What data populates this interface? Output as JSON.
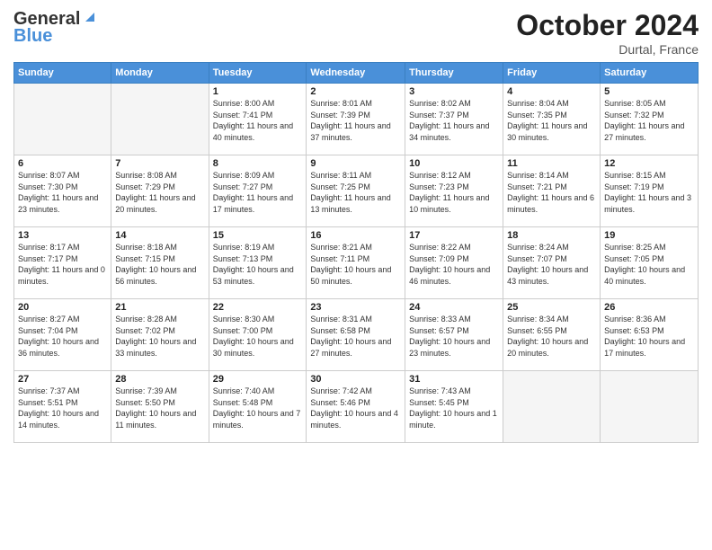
{
  "header": {
    "logo_line1": "General",
    "logo_line2": "Blue",
    "month": "October 2024",
    "location": "Durtal, France"
  },
  "days_of_week": [
    "Sunday",
    "Monday",
    "Tuesday",
    "Wednesday",
    "Thursday",
    "Friday",
    "Saturday"
  ],
  "weeks": [
    [
      {
        "day": "",
        "empty": true
      },
      {
        "day": "",
        "empty": true
      },
      {
        "day": "1",
        "info": "Sunrise: 8:00 AM\nSunset: 7:41 PM\nDaylight: 11 hours and 40 minutes."
      },
      {
        "day": "2",
        "info": "Sunrise: 8:01 AM\nSunset: 7:39 PM\nDaylight: 11 hours and 37 minutes."
      },
      {
        "day": "3",
        "info": "Sunrise: 8:02 AM\nSunset: 7:37 PM\nDaylight: 11 hours and 34 minutes."
      },
      {
        "day": "4",
        "info": "Sunrise: 8:04 AM\nSunset: 7:35 PM\nDaylight: 11 hours and 30 minutes."
      },
      {
        "day": "5",
        "info": "Sunrise: 8:05 AM\nSunset: 7:32 PM\nDaylight: 11 hours and 27 minutes."
      }
    ],
    [
      {
        "day": "6",
        "info": "Sunrise: 8:07 AM\nSunset: 7:30 PM\nDaylight: 11 hours and 23 minutes."
      },
      {
        "day": "7",
        "info": "Sunrise: 8:08 AM\nSunset: 7:29 PM\nDaylight: 11 hours and 20 minutes."
      },
      {
        "day": "8",
        "info": "Sunrise: 8:09 AM\nSunset: 7:27 PM\nDaylight: 11 hours and 17 minutes."
      },
      {
        "day": "9",
        "info": "Sunrise: 8:11 AM\nSunset: 7:25 PM\nDaylight: 11 hours and 13 minutes."
      },
      {
        "day": "10",
        "info": "Sunrise: 8:12 AM\nSunset: 7:23 PM\nDaylight: 11 hours and 10 minutes."
      },
      {
        "day": "11",
        "info": "Sunrise: 8:14 AM\nSunset: 7:21 PM\nDaylight: 11 hours and 6 minutes."
      },
      {
        "day": "12",
        "info": "Sunrise: 8:15 AM\nSunset: 7:19 PM\nDaylight: 11 hours and 3 minutes."
      }
    ],
    [
      {
        "day": "13",
        "info": "Sunrise: 8:17 AM\nSunset: 7:17 PM\nDaylight: 11 hours and 0 minutes."
      },
      {
        "day": "14",
        "info": "Sunrise: 8:18 AM\nSunset: 7:15 PM\nDaylight: 10 hours and 56 minutes."
      },
      {
        "day": "15",
        "info": "Sunrise: 8:19 AM\nSunset: 7:13 PM\nDaylight: 10 hours and 53 minutes."
      },
      {
        "day": "16",
        "info": "Sunrise: 8:21 AM\nSunset: 7:11 PM\nDaylight: 10 hours and 50 minutes."
      },
      {
        "day": "17",
        "info": "Sunrise: 8:22 AM\nSunset: 7:09 PM\nDaylight: 10 hours and 46 minutes."
      },
      {
        "day": "18",
        "info": "Sunrise: 8:24 AM\nSunset: 7:07 PM\nDaylight: 10 hours and 43 minutes."
      },
      {
        "day": "19",
        "info": "Sunrise: 8:25 AM\nSunset: 7:05 PM\nDaylight: 10 hours and 40 minutes."
      }
    ],
    [
      {
        "day": "20",
        "info": "Sunrise: 8:27 AM\nSunset: 7:04 PM\nDaylight: 10 hours and 36 minutes."
      },
      {
        "day": "21",
        "info": "Sunrise: 8:28 AM\nSunset: 7:02 PM\nDaylight: 10 hours and 33 minutes."
      },
      {
        "day": "22",
        "info": "Sunrise: 8:30 AM\nSunset: 7:00 PM\nDaylight: 10 hours and 30 minutes."
      },
      {
        "day": "23",
        "info": "Sunrise: 8:31 AM\nSunset: 6:58 PM\nDaylight: 10 hours and 27 minutes."
      },
      {
        "day": "24",
        "info": "Sunrise: 8:33 AM\nSunset: 6:57 PM\nDaylight: 10 hours and 23 minutes."
      },
      {
        "day": "25",
        "info": "Sunrise: 8:34 AM\nSunset: 6:55 PM\nDaylight: 10 hours and 20 minutes."
      },
      {
        "day": "26",
        "info": "Sunrise: 8:36 AM\nSunset: 6:53 PM\nDaylight: 10 hours and 17 minutes."
      }
    ],
    [
      {
        "day": "27",
        "info": "Sunrise: 7:37 AM\nSunset: 5:51 PM\nDaylight: 10 hours and 14 minutes."
      },
      {
        "day": "28",
        "info": "Sunrise: 7:39 AM\nSunset: 5:50 PM\nDaylight: 10 hours and 11 minutes."
      },
      {
        "day": "29",
        "info": "Sunrise: 7:40 AM\nSunset: 5:48 PM\nDaylight: 10 hours and 7 minutes."
      },
      {
        "day": "30",
        "info": "Sunrise: 7:42 AM\nSunset: 5:46 PM\nDaylight: 10 hours and 4 minutes."
      },
      {
        "day": "31",
        "info": "Sunrise: 7:43 AM\nSunset: 5:45 PM\nDaylight: 10 hours and 1 minute."
      },
      {
        "day": "",
        "empty": true
      },
      {
        "day": "",
        "empty": true
      }
    ]
  ]
}
